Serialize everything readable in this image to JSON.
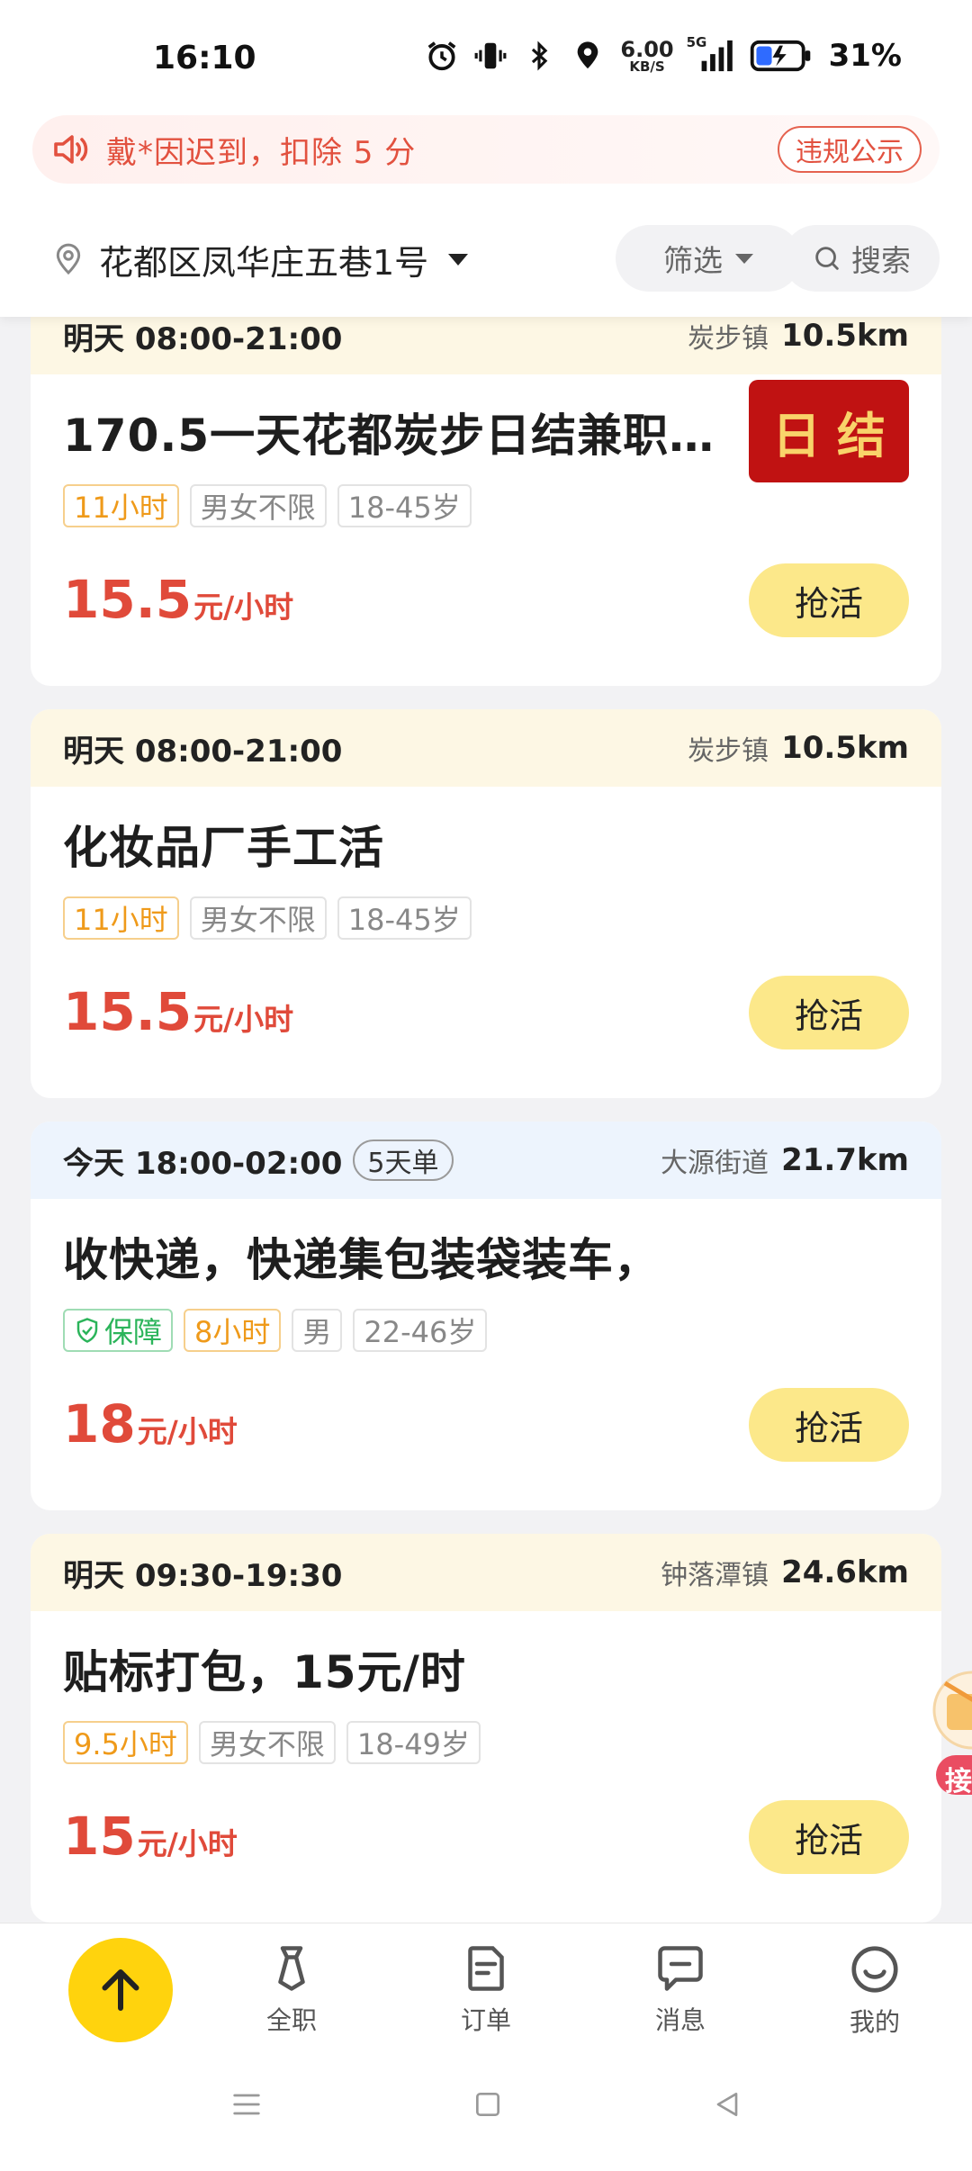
{
  "status_bar": {
    "time": "16:10",
    "icons": [
      "alarm-icon",
      "vibrate-icon",
      "bluetooth-icon",
      "location-icon",
      "signal-5g-icon"
    ],
    "net_speed": "6.00",
    "net_speed_unit": "KB/S",
    "net_type": "5G",
    "battery": "31%"
  },
  "notice": {
    "icon": "speaker-icon",
    "text": "戴*因迟到，扣除 5 分",
    "button": "违规公示"
  },
  "location_bar": {
    "location": "花都区凤华庄五巷1号",
    "filter_label": "筛选",
    "search_label": "搜索"
  },
  "jobs": [
    {
      "when": "明天 08:00-21:00",
      "place": "炭步镇",
      "distance": "10.5km",
      "title": "170.5一天花都炭步日结兼职…",
      "badge": "日结",
      "tags": [
        {
          "text": "11小时",
          "style": "orange"
        },
        {
          "text": "男女不限",
          "style": "gray"
        },
        {
          "text": "18-45岁",
          "style": "gray"
        }
      ],
      "price": "15.5",
      "price_unit": "元/小时",
      "action": "抢活"
    },
    {
      "when": "明天 08:00-21:00",
      "place": "炭步镇",
      "distance": "10.5km",
      "title": "化妆品厂手工活",
      "tags": [
        {
          "text": "11小时",
          "style": "orange"
        },
        {
          "text": "男女不限",
          "style": "gray"
        },
        {
          "text": "18-45岁",
          "style": "gray"
        }
      ],
      "price": "15.5",
      "price_unit": "元/小时",
      "action": "抢活"
    },
    {
      "when": "今天 18:00-02:00",
      "days": "5天单",
      "place": "大源街道",
      "distance": "21.7km",
      "title": "收快递，快递集包装袋装车，",
      "tags": [
        {
          "text": "保障",
          "style": "green"
        },
        {
          "text": "8小时",
          "style": "orange"
        },
        {
          "text": "男",
          "style": "gray"
        },
        {
          "text": "22-46岁",
          "style": "gray"
        }
      ],
      "price": "18",
      "price_unit": "元/小时",
      "action": "抢活"
    },
    {
      "when": "明天 09:30-19:30",
      "place": "钟落潭镇",
      "distance": "24.6km",
      "title": "贴标打包，15元/时",
      "tags": [
        {
          "text": "9.5小时",
          "style": "orange"
        },
        {
          "text": "男女不限",
          "style": "gray"
        },
        {
          "text": "18-49岁",
          "style": "gray"
        }
      ],
      "price": "15",
      "price_unit": "元/小时",
      "action": "抢活"
    }
  ],
  "floating_badge": {
    "icon": "gift-icon",
    "text": "接"
  },
  "bottom_nav": {
    "fab_icon": "arrow-up-icon",
    "items": [
      {
        "label": "全职",
        "icon": "tie-icon"
      },
      {
        "label": "订单",
        "icon": "document-icon"
      },
      {
        "label": "消息",
        "icon": "chat-icon"
      },
      {
        "label": "我的",
        "icon": "smile-icon"
      }
    ]
  },
  "colors": {
    "accent_red": "#e04a3a",
    "grab_button": "#fce88a",
    "fab": "#ffd30d",
    "daily_badge": "#c01212"
  }
}
